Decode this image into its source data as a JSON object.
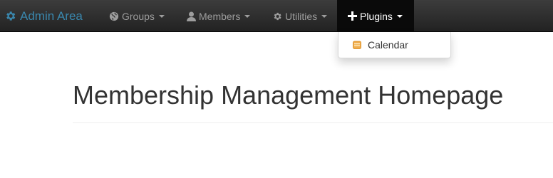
{
  "navbar": {
    "brand": {
      "label": "Admin Area",
      "icon": "gear-icon",
      "color": "#3a87ad"
    },
    "items": [
      {
        "label": "Groups",
        "icon": "globe-icon"
      },
      {
        "label": "Members",
        "icon": "user-icon"
      },
      {
        "label": "Utilities",
        "icon": "cog-icon"
      },
      {
        "label": "Plugins",
        "icon": "plus-icon",
        "active": true
      }
    ]
  },
  "dropdown": {
    "items": [
      {
        "label": "Calendar",
        "icon": "calendar-icon",
        "icon_color": "#f0ad4e"
      }
    ]
  },
  "page": {
    "title": "Membership Management Homepage"
  }
}
